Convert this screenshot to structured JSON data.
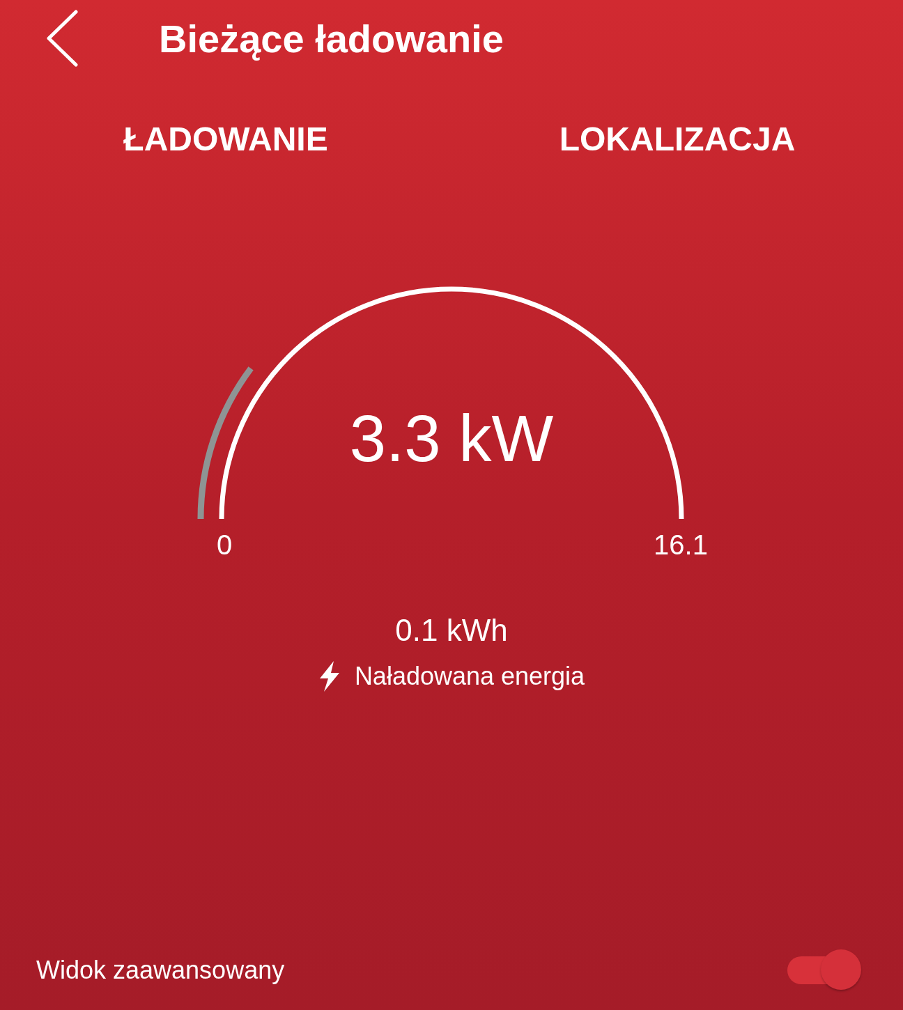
{
  "header": {
    "title": "Bieżące ładowanie"
  },
  "tabs": [
    {
      "label": "ŁADOWANIE"
    },
    {
      "label": "LOKALIZACJA"
    }
  ],
  "gauge": {
    "value": "3.3 kW",
    "min_label": "0",
    "max_label": "16.1"
  },
  "energy": {
    "value": "0.1 kWh",
    "label": "Naładowana energia"
  },
  "advanced_view": {
    "label": "Widok zaawansowany",
    "on": true
  }
}
